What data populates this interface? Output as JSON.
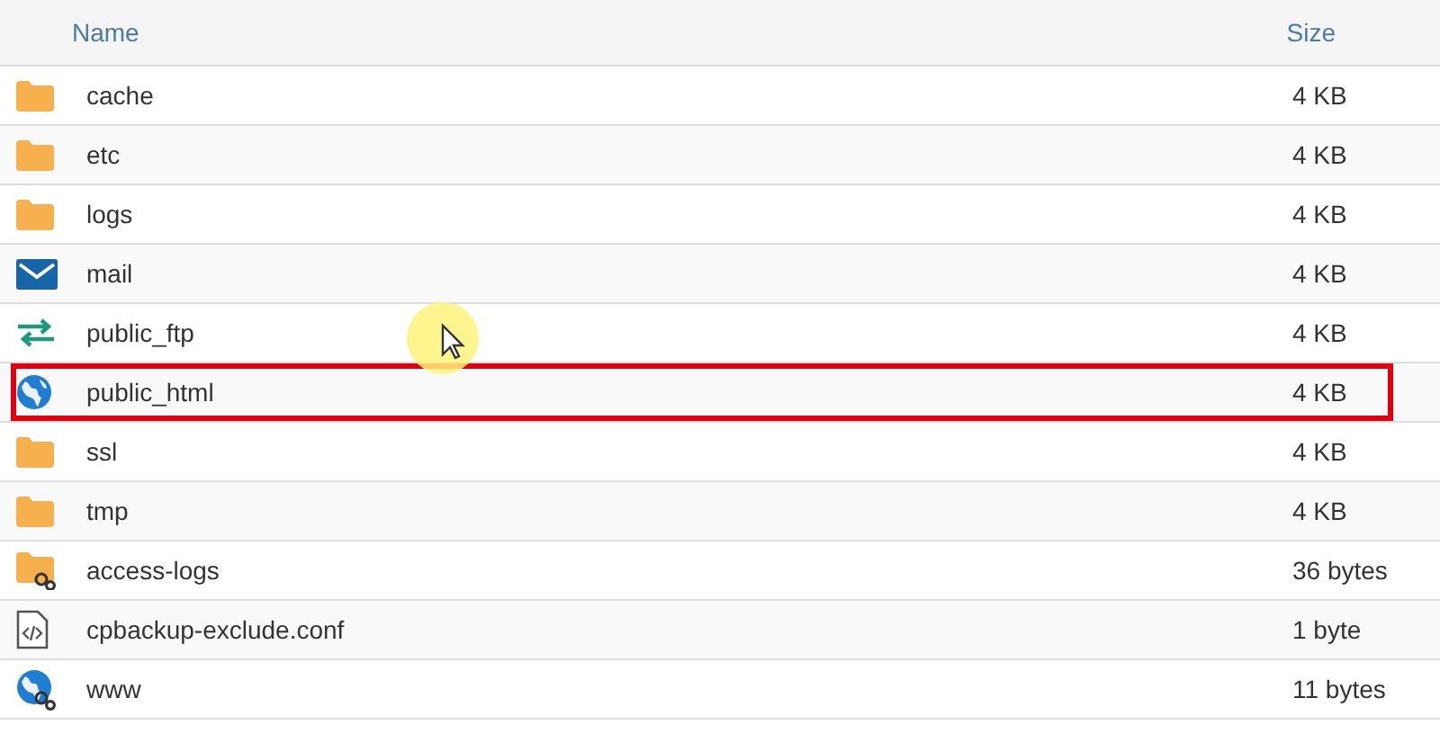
{
  "table": {
    "columns": [
      "Name",
      "Size"
    ],
    "rows": [
      {
        "kind": "folder",
        "name": "cache",
        "size": "4 KB",
        "highlighted": false
      },
      {
        "kind": "folder",
        "name": "etc",
        "size": "4 KB",
        "highlighted": false
      },
      {
        "kind": "folder",
        "name": "logs",
        "size": "4 KB",
        "highlighted": false
      },
      {
        "kind": "mail",
        "name": "mail",
        "size": "4 KB",
        "highlighted": false
      },
      {
        "kind": "ftp",
        "name": "public_ftp",
        "size": "4 KB",
        "highlighted": false
      },
      {
        "kind": "web",
        "name": "public_html",
        "size": "4 KB",
        "highlighted": true
      },
      {
        "kind": "folder",
        "name": "ssl",
        "size": "4 KB",
        "highlighted": false
      },
      {
        "kind": "folder",
        "name": "tmp",
        "size": "4 KB",
        "highlighted": false
      },
      {
        "kind": "symlink",
        "name": "access-logs",
        "size": "36 bytes",
        "highlighted": false
      },
      {
        "kind": "file",
        "name": "cpbackup-exclude.conf",
        "size": "1 byte",
        "highlighted": false
      },
      {
        "kind": "weblink",
        "name": "www",
        "size": "11 bytes",
        "highlighted": false
      }
    ]
  }
}
